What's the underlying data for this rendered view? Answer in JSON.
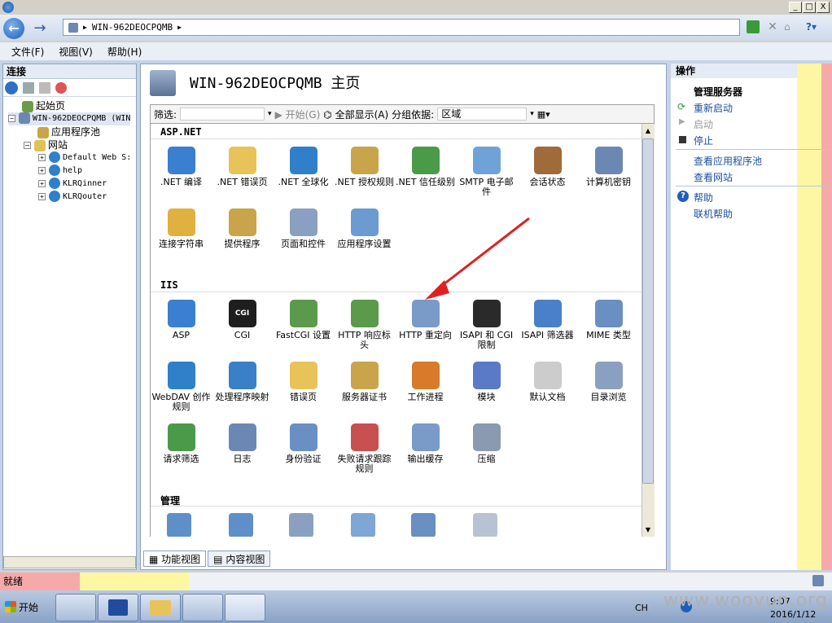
{
  "window": {
    "title_icon": "iis-globe-icon",
    "controls": [
      "_",
      "□",
      "X"
    ]
  },
  "nav": {
    "back_icon": "back-arrow-icon",
    "forward_icon": "forward-arrow-icon",
    "breadcrumb": [
      "WIN-962DEOCPQMB"
    ],
    "right_icons": [
      "refresh-icon",
      "stop-icon",
      "home-icon",
      "help-icon"
    ]
  },
  "menu": {
    "file": "文件(F)",
    "view": "视图(V)",
    "help": "帮助(H)"
  },
  "connections": {
    "header": "连接",
    "tree": {
      "start_page": "起始页",
      "server": "WIN-962DEOCPQMB (WIN",
      "app_pools": "应用程序池",
      "sites": "网站",
      "site_items": [
        "Default Web S:",
        "help",
        "KLRQinner",
        "KLRQouter"
      ]
    }
  },
  "main": {
    "title": "WIN-962DEOCPQMB 主页",
    "filter": {
      "label": "筛选:",
      "start": "开始(G)",
      "show_all": "全部显示(A)",
      "group_by_label": "分组依据:",
      "group_by_value": "区域"
    },
    "sections": [
      {
        "name": "ASP.NET",
        "items": [
          ".NET 编译",
          ".NET 错误页",
          ".NET 全球化",
          ".NET 授权规则",
          ".NET 信任级别",
          "SMTP 电子邮件",
          "会话状态",
          "计算机密钥",
          "连接字符串",
          "提供程序",
          "页面和控件",
          "应用程序设置"
        ]
      },
      {
        "name": "IIS",
        "items": [
          "ASP",
          "CGI",
          "FastCGI 设置",
          "HTTP 响应标头",
          "HTTP 重定向",
          "ISAPI 和 CGI 限制",
          "ISAPI 筛选器",
          "MIME 类型",
          "WebDAV 创作规则",
          "处理程序映射",
          "错误页",
          "服务器证书",
          "工作进程",
          "模块",
          "默认文档",
          "目录浏览",
          "请求筛选",
          "日志",
          "身份验证",
          "失败请求跟踪规则",
          "输出缓存",
          "压缩"
        ]
      },
      {
        "name": "管理",
        "items": []
      }
    ],
    "view_tabs": [
      "功能视图",
      "内容视图"
    ]
  },
  "actions": {
    "header": "操作",
    "manage_server": "管理服务器",
    "restart": "重新启动",
    "start": "启动",
    "stop": "停止",
    "view_app_pools": "查看应用程序池",
    "view_sites": "查看网站",
    "help": "帮助",
    "online_help": "联机帮助"
  },
  "status": {
    "text": "就绪"
  },
  "taskbar": {
    "start": "开始",
    "lang": "CH",
    "time": "9:07",
    "date": "2016/1/12"
  },
  "watermark": "www.wooyun.org"
}
